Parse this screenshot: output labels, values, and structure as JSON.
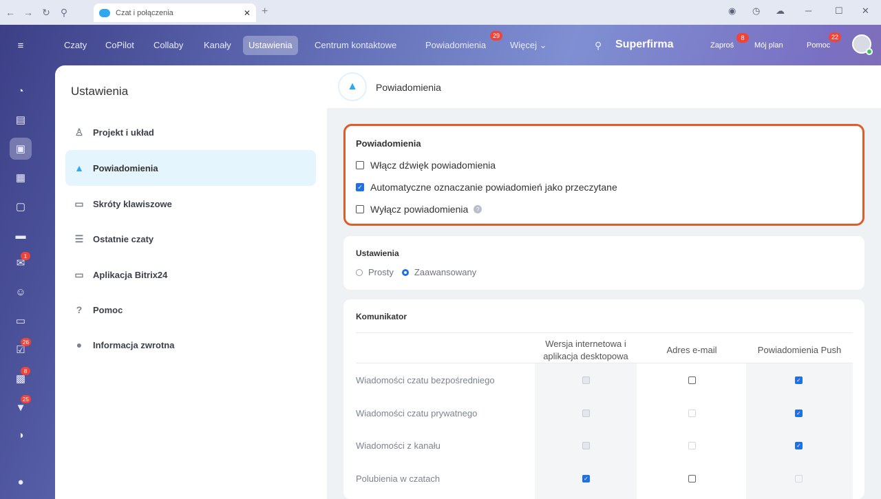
{
  "browser": {
    "tab_title": "Czat i połączenia",
    "tab_close": "✕",
    "new_tab": "+"
  },
  "topnav": {
    "items": [
      {
        "label": "Czaty"
      },
      {
        "label": "CoPilot"
      },
      {
        "label": "Collaby"
      },
      {
        "label": "Kanały"
      },
      {
        "label": "Ustawienia",
        "active": true
      },
      {
        "label": "Centrum kontaktowe"
      },
      {
        "label": "Powiadomienia",
        "badge": "29"
      },
      {
        "label": "Więcej ⌄"
      }
    ],
    "brand": "Superfirma",
    "invite": "Zaproś",
    "invite_badge": "8",
    "plan": "Mój plan",
    "help": "Pomoc",
    "help_badge": "22"
  },
  "sidebar_badges": {
    "mail": "1",
    "tasks": "26",
    "calendar": "8",
    "filter": "25"
  },
  "settings": {
    "title": "Ustawienia",
    "menu": [
      {
        "label": "Projekt i układ",
        "icon": "brush-icon"
      },
      {
        "label": "Powiadomienia",
        "icon": "bell-icon",
        "active": true
      },
      {
        "label": "Skróty klawiszowe",
        "icon": "keyboard-icon"
      },
      {
        "label": "Ostatnie czaty",
        "icon": "list-icon"
      },
      {
        "label": "Aplikacja Bitrix24",
        "icon": "monitor-icon"
      },
      {
        "label": "Pomoc",
        "icon": "question-icon"
      },
      {
        "label": "Informacja zwrotna",
        "icon": "chat-bubble-icon"
      }
    ]
  },
  "panel": {
    "title": "Powiadomienia",
    "notifications": {
      "title": "Powiadomienia",
      "options": [
        {
          "label": "Włącz dźwięk powiadomienia",
          "checked": false
        },
        {
          "label": "Automatyczne oznaczanie powiadomień jako przeczytane",
          "checked": true
        },
        {
          "label": "Wyłącz powiadomienia",
          "checked": false
        }
      ],
      "help": "?"
    },
    "mode": {
      "title": "Ustawienia",
      "simple": "Prosty",
      "advanced": "Zaawansowany",
      "selected": "Zaawansowany"
    },
    "messenger": {
      "title": "Komunikator",
      "col_web": "Wersja internetowa i aplikacja desktopowa",
      "col_email": "Adres e-mail",
      "col_push": "Powiadomienia Push",
      "rows": [
        {
          "label": "Wiadomości czatu bezpośredniego",
          "web": "disabled",
          "email": "off",
          "push": "on"
        },
        {
          "label": "Wiadomości czatu prywatnego",
          "web": "disabled",
          "email": "empty",
          "push": "on"
        },
        {
          "label": "Wiadomości z kanału",
          "web": "disabled",
          "email": "empty",
          "push": "on"
        },
        {
          "label": "Polubienia w czatach",
          "web": "on",
          "email": "off",
          "push": "empty"
        }
      ]
    }
  }
}
